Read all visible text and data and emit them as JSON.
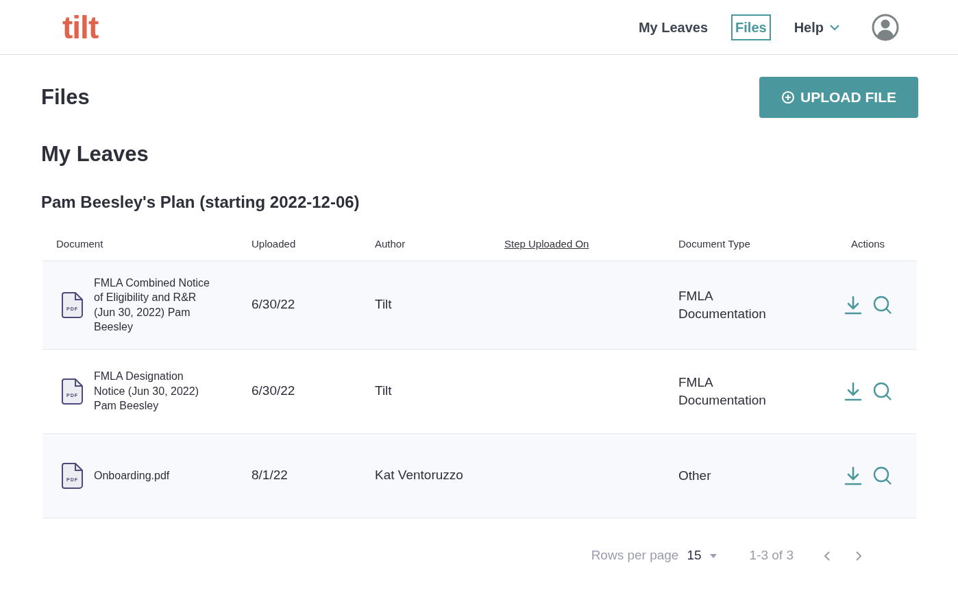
{
  "header": {
    "logo": "tilt",
    "nav": [
      {
        "label": "My Leaves",
        "selected": false,
        "kind": "link"
      },
      {
        "label": "Files",
        "selected": true,
        "kind": "link"
      },
      {
        "label": "Help",
        "selected": false,
        "kind": "menu"
      }
    ]
  },
  "page": {
    "title": "Files",
    "upload_button": "UPLOAD FILE"
  },
  "section": {
    "title": "My Leaves",
    "plan_title": "Pam Beesley's Plan (starting 2022-12-06)"
  },
  "table": {
    "columns": [
      {
        "label": "Document",
        "sortable": false
      },
      {
        "label": "Uploaded",
        "sortable": false
      },
      {
        "label": "Author",
        "sortable": false
      },
      {
        "label": "Step Uploaded On",
        "sortable": true
      },
      {
        "label": "Document Type",
        "sortable": false
      },
      {
        "label": "Actions",
        "sortable": false
      }
    ],
    "rows": [
      {
        "document": "FMLA Combined Notice of Eligibility and R&R (Jun 30, 2022) Pam Beesley",
        "file_badge": "PDF",
        "uploaded": "6/30/22",
        "author": "Tilt",
        "document_type": "FMLA Documentation"
      },
      {
        "document": "FMLA Designation Notice (Jun 30, 2022) Pam Beesley",
        "file_badge": "PDF",
        "uploaded": "6/30/22",
        "author": "Tilt",
        "document_type": "FMLA Documentation"
      },
      {
        "document": "Onboarding.pdf",
        "file_badge": "PDF",
        "uploaded": "8/1/22",
        "author": "Kat Ventoruzzo",
        "document_type": "Other"
      }
    ]
  },
  "pagination": {
    "rows_per_page_label": "Rows per page",
    "rows_per_page": "15",
    "range": "1-3 of 3"
  }
}
